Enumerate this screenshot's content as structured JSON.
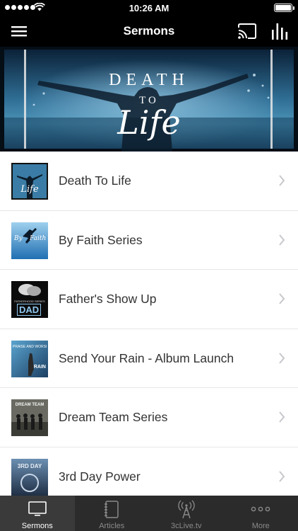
{
  "status_bar": {
    "time": "10:26 AM"
  },
  "nav": {
    "title": "Sermons"
  },
  "banner": {
    "line1": "DEATH",
    "line2": "TO",
    "line3": "Life"
  },
  "sermons": [
    {
      "title": "Death To Life"
    },
    {
      "title": "By Faith Series"
    },
    {
      "title": "Father's Show Up"
    },
    {
      "title": "Send Your Rain - Album Launch"
    },
    {
      "title": "Dream Team Series"
    },
    {
      "title": "3rd Day Power"
    }
  ],
  "thumbs": {
    "death": "Life",
    "faith_by": "By",
    "faith": "Faith",
    "dad": "DAD",
    "dad_small": "FATHERHOOD SERIES",
    "rain": "PRAISE AND WORSHIP",
    "rain_small": "RAIN",
    "dream": "DREAM TEAM",
    "power": "3RD DAY"
  },
  "tabs": [
    {
      "label": "Sermons"
    },
    {
      "label": "Articles"
    },
    {
      "label": "3cLive.tv"
    },
    {
      "label": "More"
    }
  ]
}
